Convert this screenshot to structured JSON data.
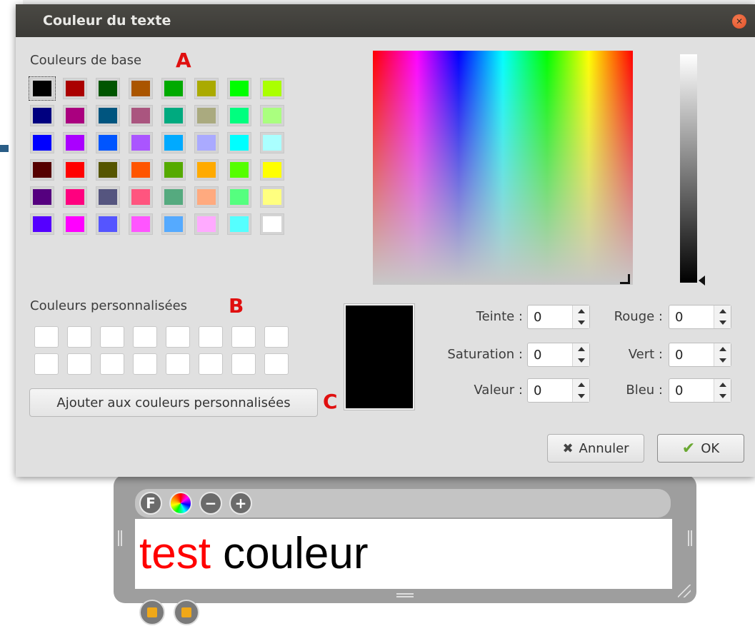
{
  "dialog": {
    "title": "Couleur du texte",
    "basic_colors_label": "Couleurs de base",
    "custom_colors_label": "Couleurs personnalisées",
    "add_custom_button": "Ajouter aux couleurs personnalisées",
    "annotations": {
      "a": "A",
      "b": "B",
      "c": "C"
    },
    "basic_colors": [
      [
        "#000000",
        "#aa0000",
        "#005500",
        "#aa5500",
        "#00aa00",
        "#aaaa00",
        "#00ff00",
        "#aaff00"
      ],
      [
        "#00007f",
        "#aa007f",
        "#00557f",
        "#aa557f",
        "#00aa7f",
        "#aaaa7f",
        "#00ff7f",
        "#aaff7f"
      ],
      [
        "#0000ff",
        "#aa00ff",
        "#0055ff",
        "#aa55ff",
        "#00aaff",
        "#aaaaff",
        "#00ffff",
        "#aaffff"
      ],
      [
        "#550000",
        "#ff0000",
        "#555500",
        "#ff5500",
        "#55aa00",
        "#ffaa00",
        "#55ff00",
        "#ffff00"
      ],
      [
        "#55007f",
        "#ff007f",
        "#55557f",
        "#ff557f",
        "#55aa7f",
        "#ffaa7f",
        "#55ff7f",
        "#ffff7f"
      ],
      [
        "#5500ff",
        "#ff00ff",
        "#5555ff",
        "#ff55ff",
        "#55aaff",
        "#ffaaff",
        "#55ffff",
        "#ffffff"
      ]
    ],
    "selected_color": "#000000",
    "fields": {
      "hue": {
        "label": "Teinte :",
        "value": "0"
      },
      "saturation": {
        "label": "Saturation :",
        "value": "0"
      },
      "value": {
        "label": "Valeur :",
        "value": "0"
      },
      "red": {
        "label": "Rouge :",
        "value": "0"
      },
      "green": {
        "label": "Vert :",
        "value": "0"
      },
      "blue": {
        "label": "Bleu :",
        "value": "0"
      }
    },
    "cancel_button": "Annuler",
    "ok_button": "OK"
  },
  "editor": {
    "text_red": "test",
    "text_black": " couleur",
    "toolbar_f": "F",
    "toolbar_minus": "−",
    "toolbar_plus": "+"
  }
}
